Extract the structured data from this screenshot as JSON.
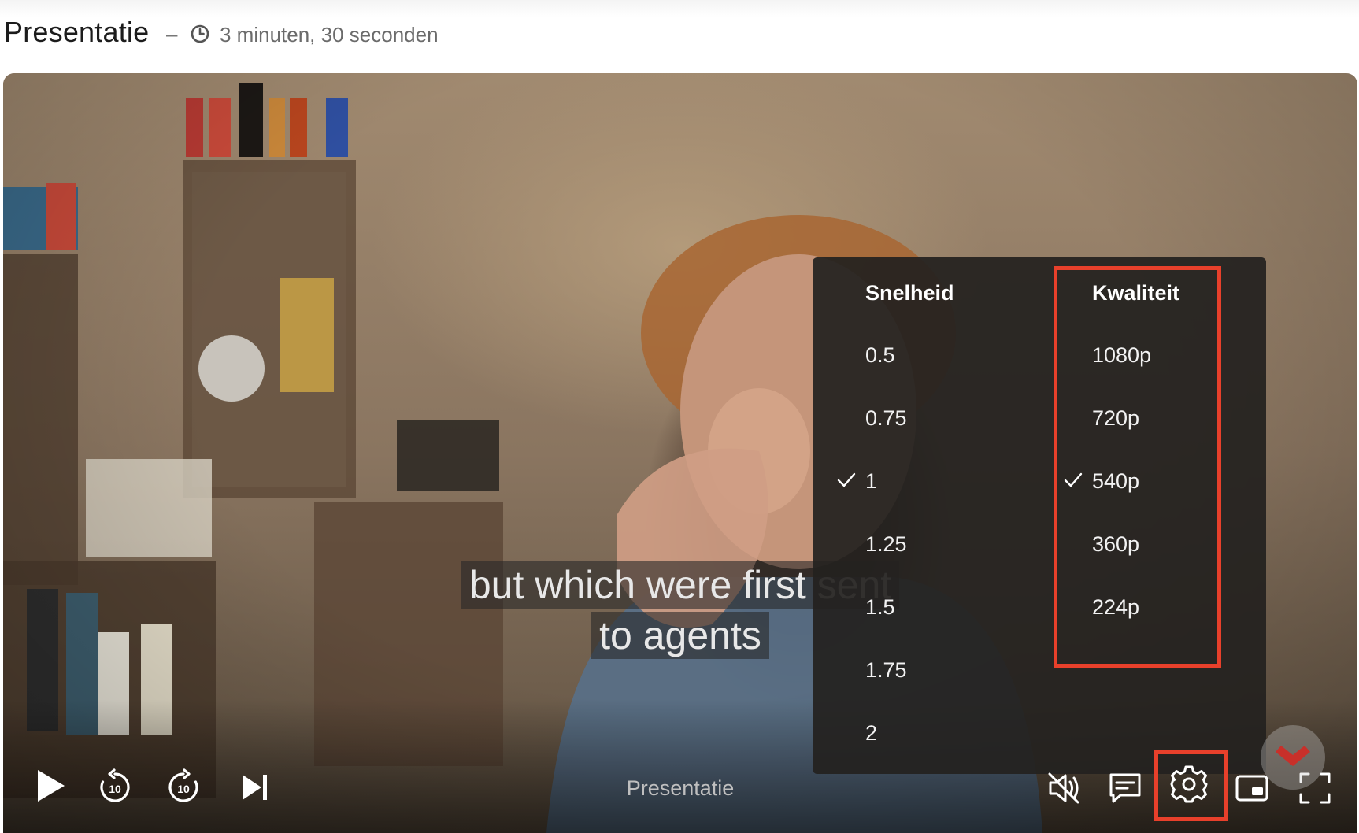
{
  "header": {
    "title": "Presentatie",
    "separator": "–",
    "duration": "3 minuten, 30 seconden",
    "duration_icon": "clock-icon"
  },
  "video": {
    "subtitle_lines": [
      "but which were first sent",
      "to agents"
    ],
    "player_title": "Presentatie"
  },
  "settings_menu": {
    "speed": {
      "label": "Snelheid",
      "options": [
        "0.5",
        "0.75",
        "1",
        "1.25",
        "1.5",
        "1.75",
        "2"
      ],
      "selected": "1"
    },
    "quality": {
      "label": "Kwaliteit",
      "options": [
        "1080p",
        "720p",
        "540p",
        "360p",
        "224p"
      ],
      "selected": "540p"
    }
  },
  "controls": {
    "left": [
      "play-icon",
      "rewind-10-icon",
      "forward-10-icon",
      "skip-next-icon"
    ],
    "skip_seconds": "10",
    "right": [
      "volume-muted-icon",
      "subtitles-icon",
      "gear-icon",
      "picture-in-picture-icon",
      "fullscreen-icon"
    ]
  },
  "colors": {
    "highlight": "#e8402b",
    "menu_background": "#23211f",
    "menu_text": "#ffffff"
  }
}
